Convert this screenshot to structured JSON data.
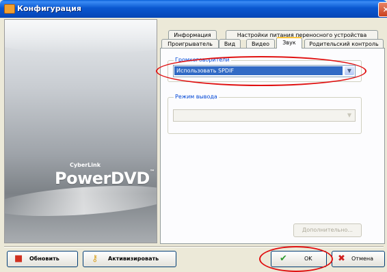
{
  "window": {
    "title": "Конфигурация",
    "close_label": "✕"
  },
  "brand": {
    "cyberlink": "CyberLink",
    "product": "PowerDVD",
    "trademark": "™"
  },
  "tabs_row1": [
    {
      "label": "Информация"
    },
    {
      "label": "Настройки питания переносного устройства"
    }
  ],
  "tabs_row2": [
    {
      "label": "Проигрыватель"
    },
    {
      "label": "Вид"
    },
    {
      "label": "Видео"
    },
    {
      "label": "Звук"
    },
    {
      "label": "Родительский контроль"
    }
  ],
  "active_tab": "Звук",
  "speaker": {
    "group_label": "Громкоговорители",
    "value": "Использовать SPDIF"
  },
  "output_mode": {
    "group_label": "Режим вывода",
    "value": ""
  },
  "advanced_button": "Дополнительно...",
  "buttons": {
    "update": "Обновить",
    "activate": "Активизировать",
    "ok": "OK",
    "cancel": "Отмена"
  },
  "colors": {
    "accent": "#316AC5",
    "annotation": "#E01010",
    "title_bar": "#0A57D0"
  }
}
